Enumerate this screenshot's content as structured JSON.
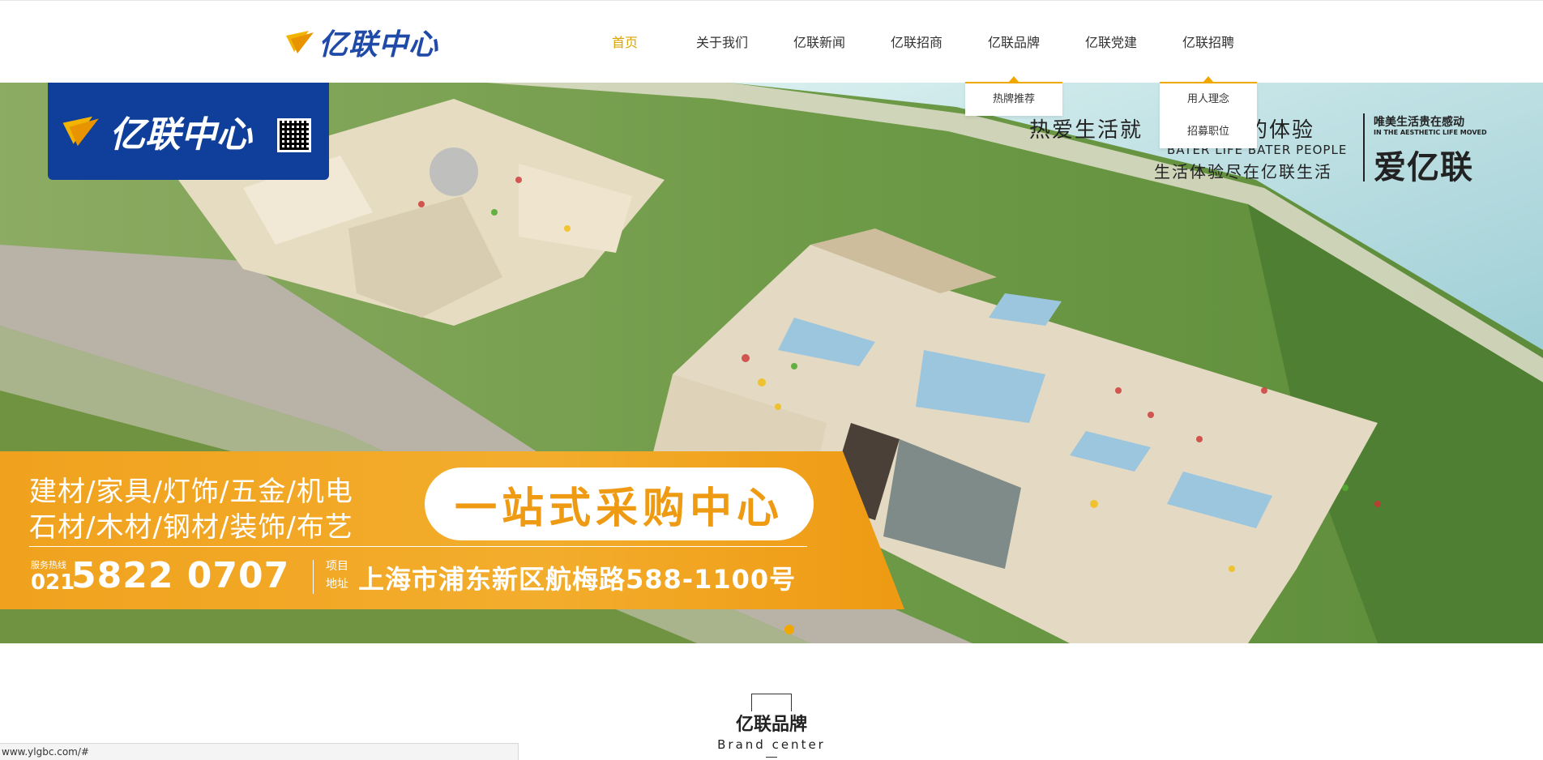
{
  "brand": {
    "logo_text": "亿联中心",
    "accent": "#d9a400",
    "blue": "#1f4aa8"
  },
  "nav": {
    "items": [
      {
        "label": "首页",
        "active": true
      },
      {
        "label": "关于我们",
        "active": false
      },
      {
        "label": "亿联新闻",
        "active": false
      },
      {
        "label": "亿联招商",
        "active": false
      },
      {
        "label": "亿联品牌",
        "active": false
      },
      {
        "label": "亿联党建",
        "active": false
      },
      {
        "label": "亿联招聘",
        "active": false
      }
    ]
  },
  "dropdowns": {
    "brand": [
      "热牌推荐"
    ],
    "recruit": [
      "用人理念",
      "招募职位"
    ]
  },
  "banner": {
    "logo_text": "亿联中心",
    "slogan_main": "热爱生活就",
    "slogan_main_tail": "好的体验",
    "slogan_en": "BATER LIFE BATER PEOPLE",
    "slogan_sub": "生活体验尽在亿联生活",
    "right_top": "唯美生活贵在感动",
    "right_en": "IN THE AESTHETIC LIFE MOVED",
    "right_big": "爱亿联",
    "line1": "建材/家具/灯饰/五金/机电",
    "line2": "石材/木材/钢材/装饰/布艺",
    "pill": "一站式采购中心",
    "hotline_label": "服务热线",
    "hotline_prefix": "021",
    "hotline_number": "5822 0707",
    "addr_label": "项目地址",
    "address": "上海市浦东新区航梅路588-1100号"
  },
  "section": {
    "title": "亿联品牌",
    "subtitle": "Brand center"
  },
  "status_url": "www.ylgbc.com/#"
}
